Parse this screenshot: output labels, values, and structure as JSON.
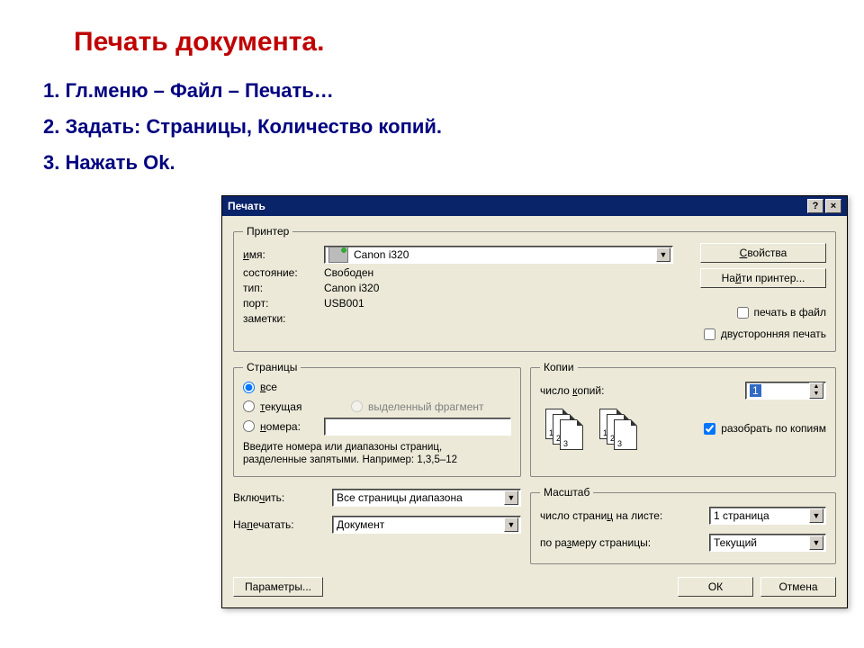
{
  "slide": {
    "title": "Печать документа.",
    "steps": [
      "1. Гл.меню – Файл – Печать…",
      "2. Задать: Страницы, Количество копий.",
      "3. Нажать Ok."
    ]
  },
  "dialog": {
    "title": "Печать",
    "help_btn": "?",
    "close_btn": "×",
    "printer": {
      "legend": "Принтер",
      "name_label": "имя:",
      "name_value": "Canon i320",
      "status_label": "состояние:",
      "status_value": "Свободен",
      "type_label": "тип:",
      "type_value": "Canon i320",
      "port_label": "порт:",
      "port_value": "USB001",
      "notes_label": "заметки:",
      "properties_btn": "Свойства",
      "find_btn": "Найти принтер...",
      "to_file": "печать в файл",
      "duplex": "двусторонняя печать"
    },
    "pages": {
      "legend": "Страницы",
      "all": "все",
      "current": "текущая",
      "selection": "выделенный фрагмент",
      "numbers": "номера:",
      "hint1": "Введите номера или диапазоны страниц,",
      "hint2": "разделенные запятыми. Например: 1,3,5–12"
    },
    "copies": {
      "legend": "Копии",
      "count_label": "число копий:",
      "count_value": "1",
      "collate": "разобрать по копиям"
    },
    "include_label": "Включить:",
    "include_value": "Все страницы диапазона",
    "print_label": "Напечатать:",
    "print_value": "Документ",
    "zoom": {
      "legend": "Масштаб",
      "pps_label": "число страниц на листе:",
      "pps_value": "1 страница",
      "scale_label": "по размеру страницы:",
      "scale_value": "Текущий"
    },
    "options_btn": "Параметры...",
    "ok_btn": "ОК",
    "cancel_btn": "Отмена"
  }
}
